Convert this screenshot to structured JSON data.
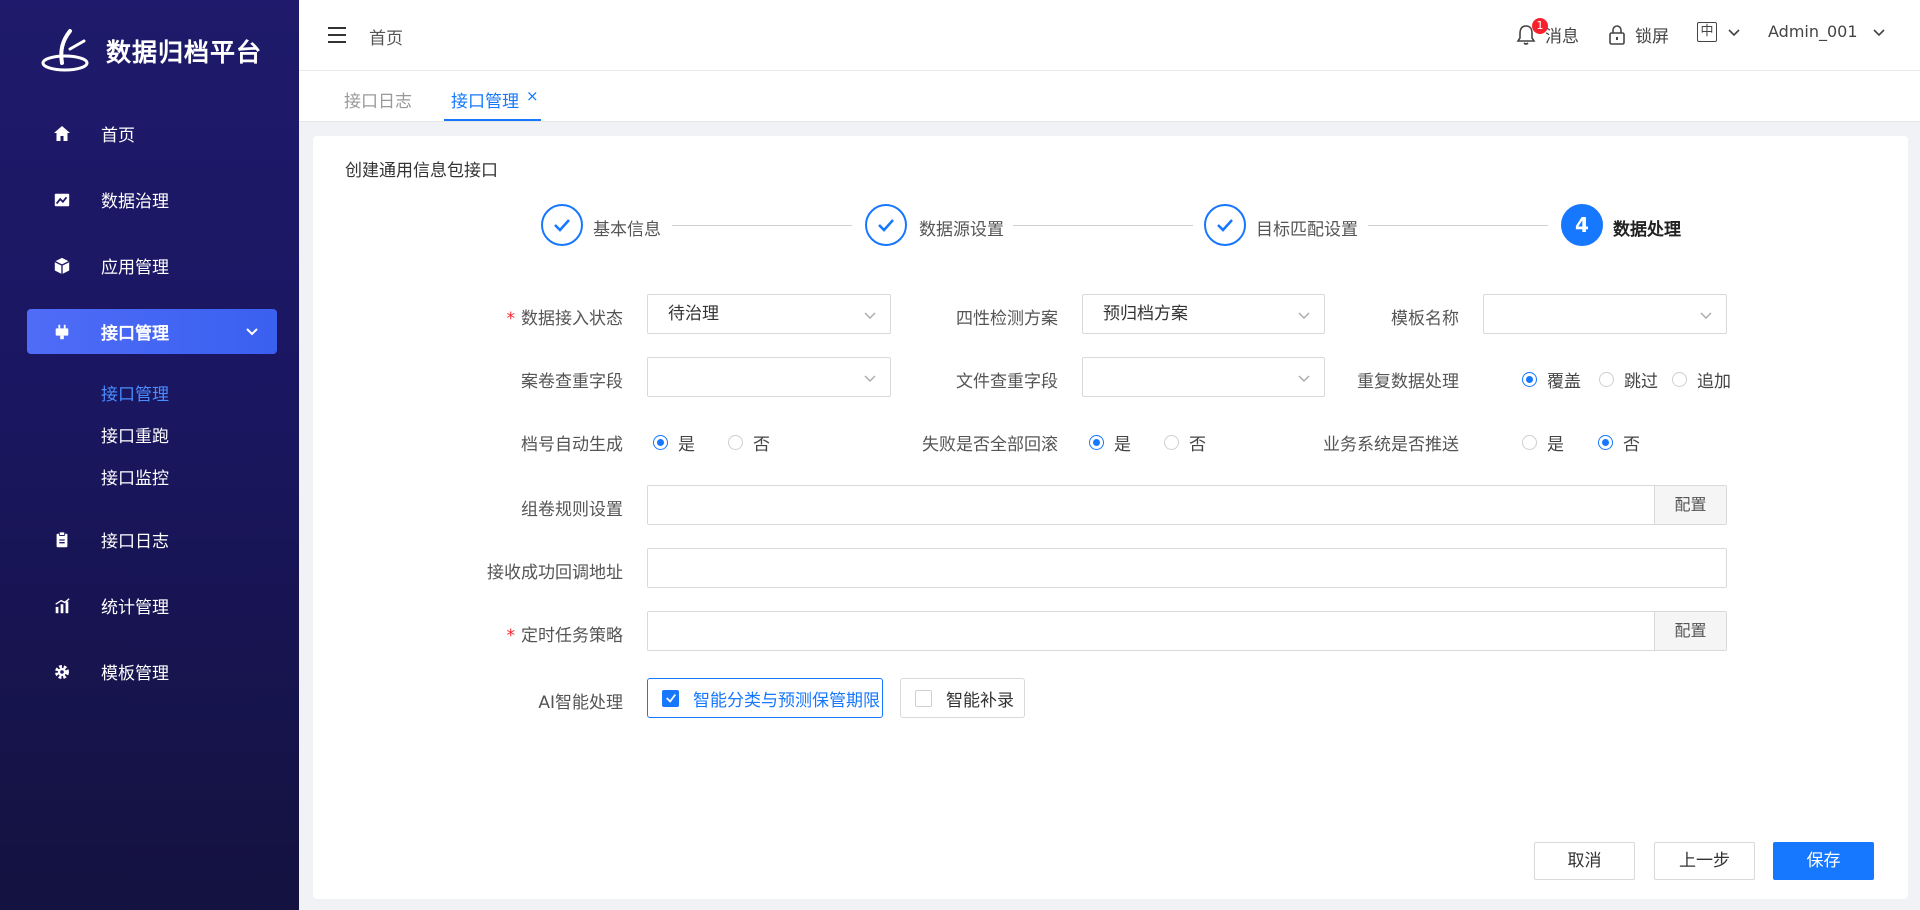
{
  "app": {
    "title": "数据归档平台"
  },
  "sidebar": {
    "items": [
      {
        "label": "首页",
        "icon": "home-icon"
      },
      {
        "label": "数据治理",
        "icon": "chart-image-icon"
      },
      {
        "label": "应用管理",
        "icon": "cube-icon"
      },
      {
        "label": "接口管理",
        "icon": "plug-icon",
        "expanded": true
      },
      {
        "label": "接口日志",
        "icon": "clipboard-icon"
      },
      {
        "label": "统计管理",
        "icon": "bar-chart-icon"
      },
      {
        "label": "模板管理",
        "icon": "gear-icon"
      }
    ],
    "sub_items": [
      {
        "label": "接口管理",
        "active": true
      },
      {
        "label": "接口重跑"
      },
      {
        "label": "接口监控"
      }
    ]
  },
  "header": {
    "breadcrumb": "首页",
    "messages_label": "消息",
    "messages_count": "1",
    "lock_label": "锁屏",
    "lang_label": "中",
    "user": "Admin_001"
  },
  "tabs": [
    {
      "label": "接口日志"
    },
    {
      "label": "接口管理",
      "active": true,
      "close": "×"
    }
  ],
  "form": {
    "title": "创建通用信息包接口",
    "steps": [
      {
        "label": "基本信息",
        "done": true
      },
      {
        "label": "数据源设置",
        "done": true
      },
      {
        "label": "目标匹配设置",
        "done": true
      },
      {
        "label": "数据处理",
        "number": "4",
        "current": true
      }
    ],
    "fields": {
      "access_status": {
        "label": "数据接入状态",
        "value": "待治理",
        "required": true
      },
      "four_check": {
        "label": "四性检测方案",
        "value": "预归档方案"
      },
      "template_name": {
        "label": "模板名称",
        "value": ""
      },
      "case_dedup": {
        "label": "案卷查重字段",
        "value": ""
      },
      "file_dedup": {
        "label": "文件查重字段",
        "value": ""
      },
      "dup_handling": {
        "label": "重复数据处理",
        "options": [
          "覆盖",
          "跳过",
          "追加"
        ],
        "selected": "覆盖"
      },
      "auto_archive_no": {
        "label": "档号自动生成",
        "options": [
          "是",
          "否"
        ],
        "selected": "是"
      },
      "rollback": {
        "label": "失败是否全部回滚",
        "options": [
          "是",
          "否"
        ],
        "selected": "是"
      },
      "push_biz": {
        "label": "业务系统是否推送",
        "options": [
          "是",
          "否"
        ],
        "selected": "否"
      },
      "volume_rule": {
        "label": "组卷规则设置",
        "value": "",
        "button": "配置"
      },
      "callback_url": {
        "label": "接收成功回调地址",
        "value": ""
      },
      "schedule": {
        "label": "定时任务策略",
        "value": "",
        "button": "配置",
        "required": true
      },
      "ai": {
        "label": "AI智能处理",
        "options": [
          {
            "label": "智能分类与预测保管期限",
            "checked": true
          },
          {
            "label": "智能补录",
            "checked": false
          }
        ]
      }
    },
    "buttons": {
      "cancel": "取消",
      "prev": "上一步",
      "save": "保存"
    }
  },
  "colors": {
    "primary": "#1677ff",
    "sidebar": "#1f1a6b",
    "danger": "#f5222d"
  }
}
